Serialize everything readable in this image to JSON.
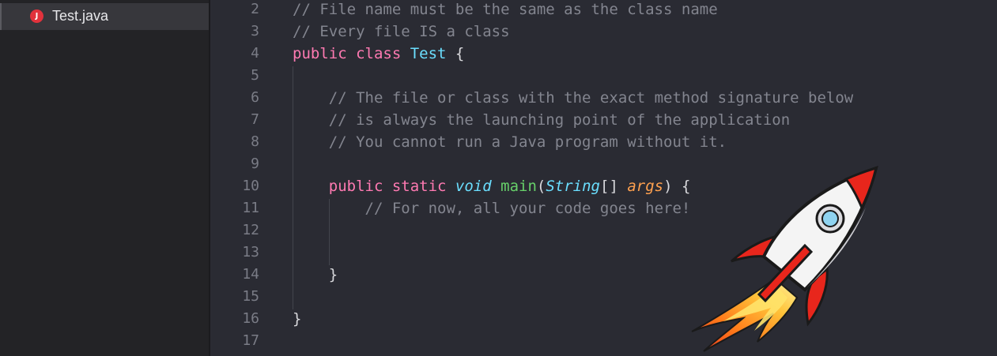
{
  "sidebar": {
    "file": {
      "icon": "java-file-icon",
      "icon_letter": "J",
      "name": "Test.java"
    }
  },
  "editor": {
    "line_numbers": [
      "2",
      "3",
      "4",
      "5",
      "6",
      "7",
      "8",
      "9",
      "10",
      "11",
      "12",
      "13",
      "14",
      "15",
      "16",
      "17"
    ],
    "lines": [
      [
        {
          "t": "comment",
          "v": "// File name must be the same as the class name"
        }
      ],
      [
        {
          "t": "comment",
          "v": "// Every file IS a class"
        }
      ],
      [
        {
          "t": "keyword",
          "v": "public class "
        },
        {
          "t": "type",
          "v": "Test"
        },
        {
          "t": "plain",
          "v": " {"
        }
      ],
      [],
      [
        {
          "t": "plain",
          "v": "    "
        },
        {
          "t": "comment",
          "v": "// The file or class with the exact method signature below"
        }
      ],
      [
        {
          "t": "plain",
          "v": "    "
        },
        {
          "t": "comment",
          "v": "// is always the launching point of the application"
        }
      ],
      [
        {
          "t": "plain",
          "v": "    "
        },
        {
          "t": "comment",
          "v": "// You cannot run a Java program without it."
        }
      ],
      [],
      [
        {
          "t": "plain",
          "v": "    "
        },
        {
          "t": "keyword",
          "v": "public static "
        },
        {
          "t": "italic-type",
          "v": "void"
        },
        {
          "t": "plain",
          "v": " "
        },
        {
          "t": "func",
          "v": "main"
        },
        {
          "t": "plain",
          "v": "("
        },
        {
          "t": "italic-type",
          "v": "String"
        },
        {
          "t": "plain",
          "v": "[] "
        },
        {
          "t": "param",
          "v": "args"
        },
        {
          "t": "plain",
          "v": ") {"
        }
      ],
      [
        {
          "t": "plain",
          "v": "        "
        },
        {
          "t": "comment",
          "v": "// For now, all your code goes here!"
        }
      ],
      [],
      [],
      [
        {
          "t": "plain",
          "v": "    }"
        }
      ],
      [],
      [
        {
          "t": "plain",
          "v": "}"
        }
      ],
      []
    ]
  },
  "decoration": {
    "rocket_icon": "rocket-icon"
  },
  "colors": {
    "editor_bg": "#2a2b33",
    "sidebar_bg": "#232326",
    "comment": "#83858f",
    "keyword": "#ff7ab2",
    "type": "#6bdfff",
    "function": "#67d16a",
    "parameter": "#ffa14f",
    "java_badge": "#e1323c"
  }
}
